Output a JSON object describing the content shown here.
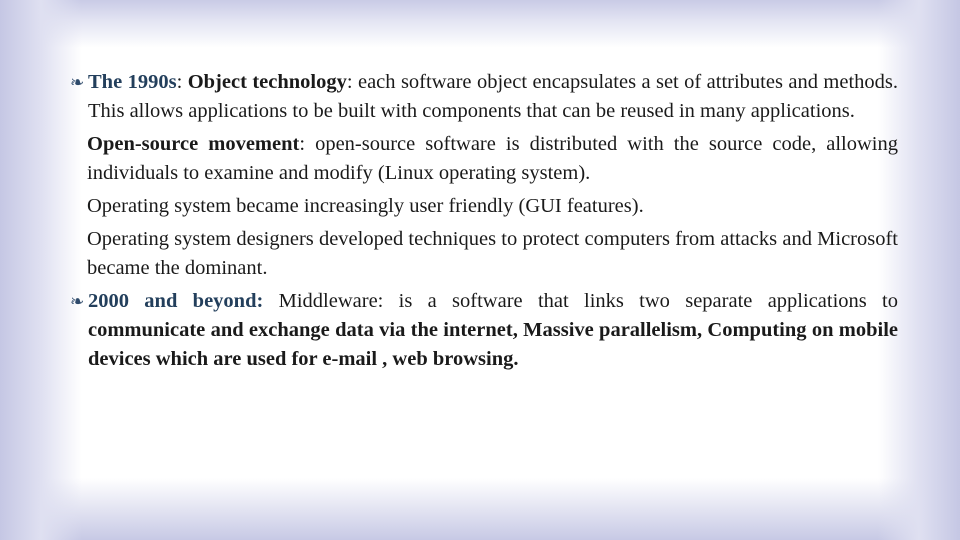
{
  "slide": {
    "bullet_icon": "❧",
    "paragraphs": [
      {
        "bullet": true,
        "lead": "The 1990s",
        "sep1": ": ",
        "term": "Object technology",
        "rest": ": each software object encapsulates a set of attributes and methods. This allows applications to be built with components that can be reused in many applications."
      },
      {
        "bullet": false,
        "term": "Open-source movement",
        "rest": ": open-source software is distributed with the source code, allowing individuals to examine and modify (Linux operating system)."
      },
      {
        "bullet": false,
        "text": "Operating system became increasingly user friendly (GUI features)."
      },
      {
        "bullet": false,
        "text": "Operating system designers developed techniques to protect computers from attacks and Microsoft became the dominant."
      },
      {
        "bullet": true,
        "lead": "2000 and beyond:",
        "rest_plain": " Middleware: is a software that links two separate applications to ",
        "rest_bold": "communicate and exchange data via the internet, Massive parallelism, Computing on mobile devices which are used for e-mail , web browsing."
      }
    ]
  }
}
